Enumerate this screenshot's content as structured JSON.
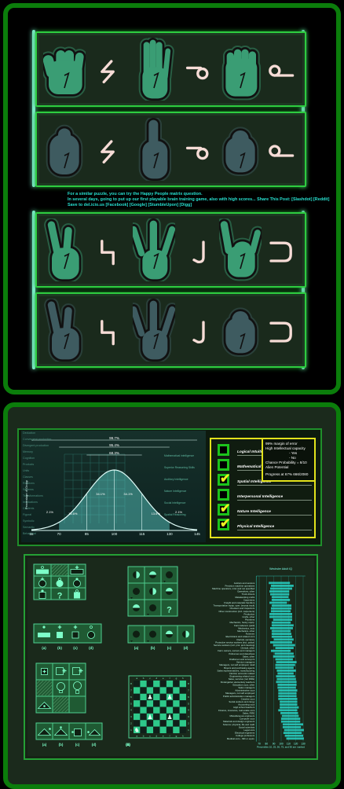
{
  "colors": {
    "frame": "#0b7d0b",
    "row_border": "#2ecc40",
    "hand_green": "#3a9d74",
    "hand_grey": "#3e5b60",
    "symbol": "#f6dcd6",
    "note": "#27e0cf",
    "check": "#1cc21c",
    "checkmark": "#f0f020",
    "info_border": "#e2e21c",
    "bar": "#28d6c8"
  },
  "hand_rows": [
    {
      "tone": "green",
      "items": [
        {
          "kind": "hand",
          "variant": "fist-front"
        },
        {
          "kind": "symbol",
          "glyph": "zigzag"
        },
        {
          "kind": "hand",
          "variant": "flat-hand"
        },
        {
          "kind": "symbol",
          "glyph": "hook-circle"
        },
        {
          "kind": "hand",
          "variant": "fist-palm"
        },
        {
          "kind": "symbol",
          "glyph": "circle-tail"
        }
      ]
    },
    {
      "tone": "grey",
      "items": [
        {
          "kind": "hand",
          "variant": "fist-thumb"
        },
        {
          "kind": "symbol",
          "glyph": "zigzag"
        },
        {
          "kind": "hand",
          "variant": "one-finger"
        },
        {
          "kind": "symbol",
          "glyph": "hook-circle"
        },
        {
          "kind": "hand",
          "variant": "fist-closed"
        },
        {
          "kind": "symbol",
          "glyph": "circle-tail"
        }
      ]
    },
    {
      "tone": "green",
      "items": [
        {
          "kind": "hand",
          "variant": "two-fingers"
        },
        {
          "kind": "symbol",
          "glyph": "step"
        },
        {
          "kind": "hand",
          "variant": "three-fingers"
        },
        {
          "kind": "symbol",
          "glyph": "hook-j"
        },
        {
          "kind": "hand",
          "variant": "horns"
        },
        {
          "kind": "symbol",
          "glyph": "bracket"
        }
      ]
    },
    {
      "tone": "grey",
      "items": [
        {
          "kind": "hand",
          "variant": "two-fingers"
        },
        {
          "kind": "symbol",
          "glyph": "step"
        },
        {
          "kind": "hand",
          "variant": "three-fingers"
        },
        {
          "kind": "symbol",
          "glyph": "hook-j"
        },
        {
          "kind": "hand",
          "variant": "fist-closed"
        },
        {
          "kind": "symbol",
          "glyph": "bracket"
        }
      ]
    }
  ],
  "note": {
    "line1": "For a similar puzzle, you can try the Happy People matrix question.",
    "line2": "In several days, going to put up our first playable brain training game, also with high scores... Share This Post: [Slashdot] [Reddit]",
    "line3": "Save to del.icio.us [Facebook] [Google] [StumbleUpon] [Digg]"
  },
  "bell": {
    "mean": 100,
    "sd": 15,
    "xlim": [
      55,
      145
    ],
    "ticks": [
      "55",
      "70",
      "85",
      "100",
      "115",
      "130",
      "145"
    ],
    "ylabel": "Percentage of Group",
    "spans": [
      "99.7%",
      "95.4%",
      "68.3%"
    ],
    "region_labels": [
      "2.1%",
      "13.6%",
      "34.1%",
      "34.1%",
      "13.6%",
      "2.1%"
    ],
    "left_labels": [
      "Deduction",
      "Convergent production",
      "Divergent production",
      "Memory",
      "Cognition",
      "Products",
      "Units",
      "Classes",
      "Relations",
      "Systems",
      "Transformations",
      "Implications",
      "Contents",
      "Figural",
      "Symbolic",
      "Semantic",
      "Behavioral"
    ],
    "right_labels": [
      "Mathematical intelligence",
      "Superior Reasoning Skills",
      "Auditory Intelligence",
      "Nature Intelligence",
      "Social Intelligence",
      "Spatial Reasoning"
    ]
  },
  "checklist": [
    {
      "label": "Logical Intuition",
      "checked": false
    },
    {
      "label": "Mathematical Intuition",
      "checked": false
    },
    {
      "label": "Spatial Intelligence",
      "checked": true
    },
    {
      "label": "Interpersonal Intelligence",
      "checked": false
    },
    {
      "label": "Nature Intelligence",
      "checked": true
    },
    {
      "label": "Physical Intelligence",
      "checked": true
    }
  ],
  "check_mark": "✔",
  "info": {
    "l1": "99% margin of error",
    "l2": "High Intellectual capacity",
    "l3": "- Yes",
    "l4": "- No",
    "l5": "Chance Probability = 8/10",
    "l6": "Alien Potential",
    "l7": "Progress at 67%    666/2080"
  },
  "answer_labels": [
    "(a)",
    "(b)",
    "(c)",
    "(d)"
  ],
  "puzzle1": {
    "grid": [
      [
        {
          "top": "diamond",
          "shape": "rect-light"
        },
        {
          "shape": "hatch"
        },
        {
          "top": "plus",
          "shape": "rect-dark"
        }
      ],
      [
        {
          "top": "plus",
          "shape": "circle-dark"
        },
        {
          "top": "diamond",
          "shape": "circle-light"
        },
        {
          "top": "dot",
          "shape": "circle-dark"
        }
      ],
      [
        {
          "top": "dot",
          "shape": "square-dark"
        },
        {
          "shape": "question"
        },
        {
          "top": "diamond",
          "shape": "square-light"
        }
      ]
    ],
    "answers": [
      {
        "top": "dot",
        "shape": "rect-light"
      },
      {
        "top": "plus",
        "shape": "square-light"
      },
      {
        "top": "plus",
        "shape": "square-dark"
      },
      {
        "top": "diamond",
        "shape": "circle-dark"
      }
    ]
  },
  "puzzle2": {
    "grid": [
      [
        {
          "shape": "half-v"
        },
        {
          "shape": "half-h"
        },
        {
          "shape": "ball"
        }
      ],
      [
        {
          "shape": "ball"
        },
        {
          "shape": "half-v"
        },
        {
          "shape": "half-h"
        }
      ],
      [
        {
          "shape": "half-h"
        },
        {
          "shape": "ball"
        },
        {
          "shape": "question"
        }
      ]
    ],
    "answers": [
      {
        "shape": "ball"
      },
      {
        "shape": "ball"
      },
      {
        "shape": "half-h"
      },
      {
        "shape": "half-v"
      }
    ]
  },
  "puzzle3": {
    "grid": [
      [
        {
          "shape": "square-plus"
        },
        {
          "shape": "square-plus-out"
        },
        {
          "shape": "square-plus-out"
        }
      ],
      [
        {
          "shape": "hatch"
        },
        {
          "shape": "bulb"
        },
        {
          "shape": "bulb-box"
        }
      ],
      [
        {
          "shape": "triangle-dot"
        },
        {
          "shape": "hatch"
        },
        {
          "shape": "empty"
        }
      ]
    ],
    "answers": [
      {
        "shape": "triangle-dot-right"
      },
      {
        "shape": "triangle-dot-top"
      },
      {
        "shape": "dot-square"
      },
      {
        "shape": "dot-triangle"
      }
    ]
  },
  "chess": {
    "files": [
      "a",
      "b",
      "c",
      "d",
      "e",
      "f",
      "g",
      "h"
    ],
    "ranks": [
      "8",
      "7",
      "6",
      "5",
      "4",
      "3",
      "2",
      "1"
    ],
    "pieces": [
      {
        "piece": "pawn",
        "square": "c6"
      },
      {
        "piece": "pawn",
        "square": "f6"
      },
      {
        "piece": "pawn",
        "square": "c3"
      },
      {
        "piece": "pawn",
        "square": "f3"
      },
      {
        "piece": "knight",
        "square": "a1"
      }
    ]
  },
  "chart_data": {
    "type": "bar",
    "orientation": "horizontal",
    "title": "Wechsler Adult IQ",
    "xlabel": "Percentiles 10, 25, 50, 75, and 90 are marked",
    "xticks": [
      70,
      80,
      90,
      100,
      110,
      120,
      130
    ],
    "xlim": [
      66,
      133
    ],
    "categories": [
      "Janitors and sextons",
      "Precision machine operatives",
      "Machine operators, misc and not specified",
      "Operatives, other",
      "Truck drivers",
      "Metalworking crafts",
      "Carpenters",
      "Freight and materials handlers",
      "Transportation equip. oper. (except truck)",
      "Checkers and inspectors",
      "Other construction (incl. carpenters)",
      "Production",
      "Crafts, other",
      "Plumbers",
      "Mechanics, heavy equip.",
      "Farm laborers (paid)",
      "Mechanics, auto",
      "Mechanics, other",
      "Foremen",
      "Electricians and related occs",
      "Clerical, secretary",
      "Protective service workers (incl. police)",
      "Service workers (incl. prot. and cleaning)",
      "Clerical, other",
      "Farm owners, owners and managers",
      "Policemen and detectives",
      "Sales, other",
      "Draftsmen and surveyors",
      "Service managers",
      "Managers, not self employed, retail",
      "Buyers and purchasing agents",
      "Sales representatives, manufacturing",
      "Clerical, accounts related",
      "Engineering related occs",
      "Sales, services (not FIRE)",
      "Kindergarten elementary teachers",
      "Education occs, other",
      "Sales managers",
      "Administrative occs",
      "Managers, not self employed",
      "Public administration managers",
      "Creative occs",
      "Social workers and clergy",
      "Accounting occs",
      "High school teachers",
      "Finance, insurance, real estate occs",
      "Sales, FIRE",
      "Miscellaneous engineers",
      "Computer occs",
      "Materials and design engineers",
      "Science: physical, life and math",
      "Social scientists",
      "Legal occs",
      "Electrical engineers",
      "College professors",
      "Medical occs - MD or equiv."
    ],
    "ranges": [
      [
        83,
        112
      ],
      [
        86,
        117
      ],
      [
        85,
        115
      ],
      [
        84,
        111
      ],
      [
        85,
        111
      ],
      [
        87,
        110
      ],
      [
        87,
        112
      ],
      [
        84,
        108
      ],
      [
        87,
        114
      ],
      [
        86,
        114
      ],
      [
        86,
        113
      ],
      [
        84,
        115
      ],
      [
        84,
        115
      ],
      [
        89,
        115
      ],
      [
        87,
        113
      ],
      [
        87,
        117
      ],
      [
        85,
        116
      ],
      [
        87,
        113
      ],
      [
        87,
        114
      ],
      [
        87,
        115
      ],
      [
        90,
        117
      ],
      [
        85,
        115
      ],
      [
        89,
        119
      ],
      [
        92,
        117
      ],
      [
        86,
        113
      ],
      [
        91,
        117
      ],
      [
        89,
        118
      ],
      [
        92,
        116
      ],
      [
        93,
        121
      ],
      [
        92,
        119
      ],
      [
        92,
        117
      ],
      [
        94,
        120
      ],
      [
        95,
        117
      ],
      [
        93,
        119
      ],
      [
        94,
        120
      ],
      [
        93,
        121
      ],
      [
        95,
        121
      ],
      [
        95,
        120
      ],
      [
        96,
        122
      ],
      [
        96,
        121
      ],
      [
        96,
        121
      ],
      [
        96,
        122
      ],
      [
        98,
        122
      ],
      [
        98,
        122
      ],
      [
        98,
        124
      ],
      [
        96,
        122
      ],
      [
        99,
        123
      ],
      [
        101,
        124
      ],
      [
        100,
        126
      ],
      [
        100,
        126
      ],
      [
        102,
        130
      ],
      [
        102,
        127
      ],
      [
        104,
        131
      ],
      [
        103,
        128
      ],
      [
        105,
        130
      ],
      [
        107,
        131
      ]
    ]
  }
}
